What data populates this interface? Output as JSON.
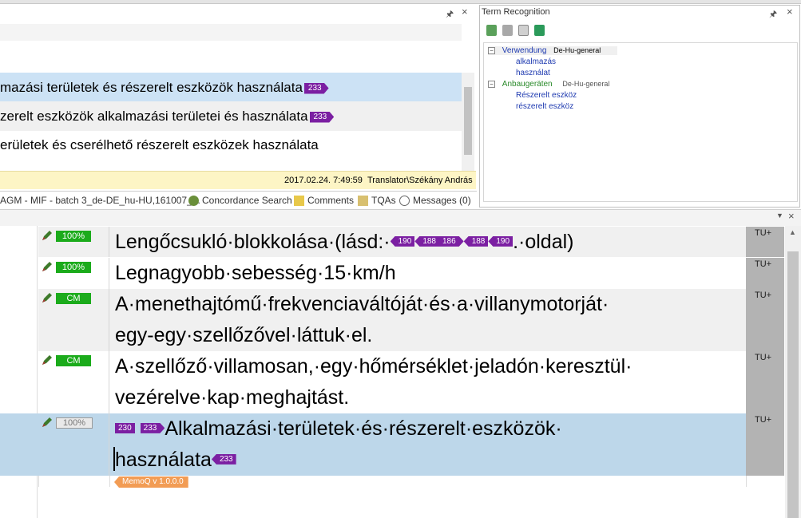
{
  "top_pane": {
    "pin_icon": "pin-icon",
    "close_icon": "close-icon",
    "rows": [
      {
        "text": "mazási területek és részerelt eszközök használata",
        "tag": "233"
      },
      {
        "text": "zerelt eszközök alkalmazási területei és használata",
        "tag": "233"
      },
      {
        "text": "erületek és cserélhető részerelt eszközek használata",
        "tag": ""
      }
    ],
    "info_date": "2017.02.24. 7:49:59",
    "info_user": "Translator\\Székány András"
  },
  "tabs": {
    "project": "AGM - MIF - batch 3_de-DE_hu-HU,161007_...",
    "concordance": "Concordance Search",
    "comments": "Comments",
    "tqas": "TQAs",
    "messages": "Messages (0)"
  },
  "term_recognition": {
    "title": "Term Recognition",
    "entries": [
      {
        "term": "Verwendung",
        "db": "De-Hu-general",
        "translations": [
          "alkalmazás",
          "használat"
        ]
      },
      {
        "term": "Anbaugeräten",
        "db": "De-Hu-general",
        "translations": [
          "Részerelt eszköz",
          "részerelt eszköz"
        ]
      }
    ]
  },
  "grid": {
    "rows": [
      {
        "status": "100%",
        "status_style": "green",
        "tu": "TU+",
        "before": "Lengőcsukló·blokkolása·(lásd:·",
        "tags": [
          "190",
          "188",
          "186",
          "188",
          "190"
        ],
        "after": ".·oldal)"
      },
      {
        "status": "100%",
        "status_style": "green",
        "tu": "TU+",
        "line1": "Legnagyobb·sebesség·15·km/h"
      },
      {
        "status": "CM",
        "status_style": "green",
        "tu": "TU+",
        "line1": "A·menethajtómű·frekvenciaváltóját·és·a·villanymotorját·",
        "line2": "egy-egy·szellőzővel·láttuk·el."
      },
      {
        "status": "CM",
        "status_style": "green",
        "tu": "TU+",
        "line1": "A·szellőző·villamosan,·egy·hőmérséklet·jeladón·keresztül·",
        "line2": "vezérelve·kap·meghajtást."
      },
      {
        "status": "100%",
        "status_style": "empty",
        "tu": "TU+",
        "tag_a": "230",
        "tag_b": "233",
        "line1": "Alkalmazási·területek·és·részerelt·eszközök·",
        "line2": "használata",
        "tag_end": "233"
      }
    ],
    "memoq_label": "MemoQ v 1.0.0.0"
  },
  "colors": {
    "selected_row": "#cce2f5",
    "selected_grid": "#bdd7ea",
    "tag_purple": "#7b1fa2",
    "status_green": "#1bab1b",
    "info_yellow": "#fdf5c5",
    "memoq_orange": "#f29c54"
  }
}
